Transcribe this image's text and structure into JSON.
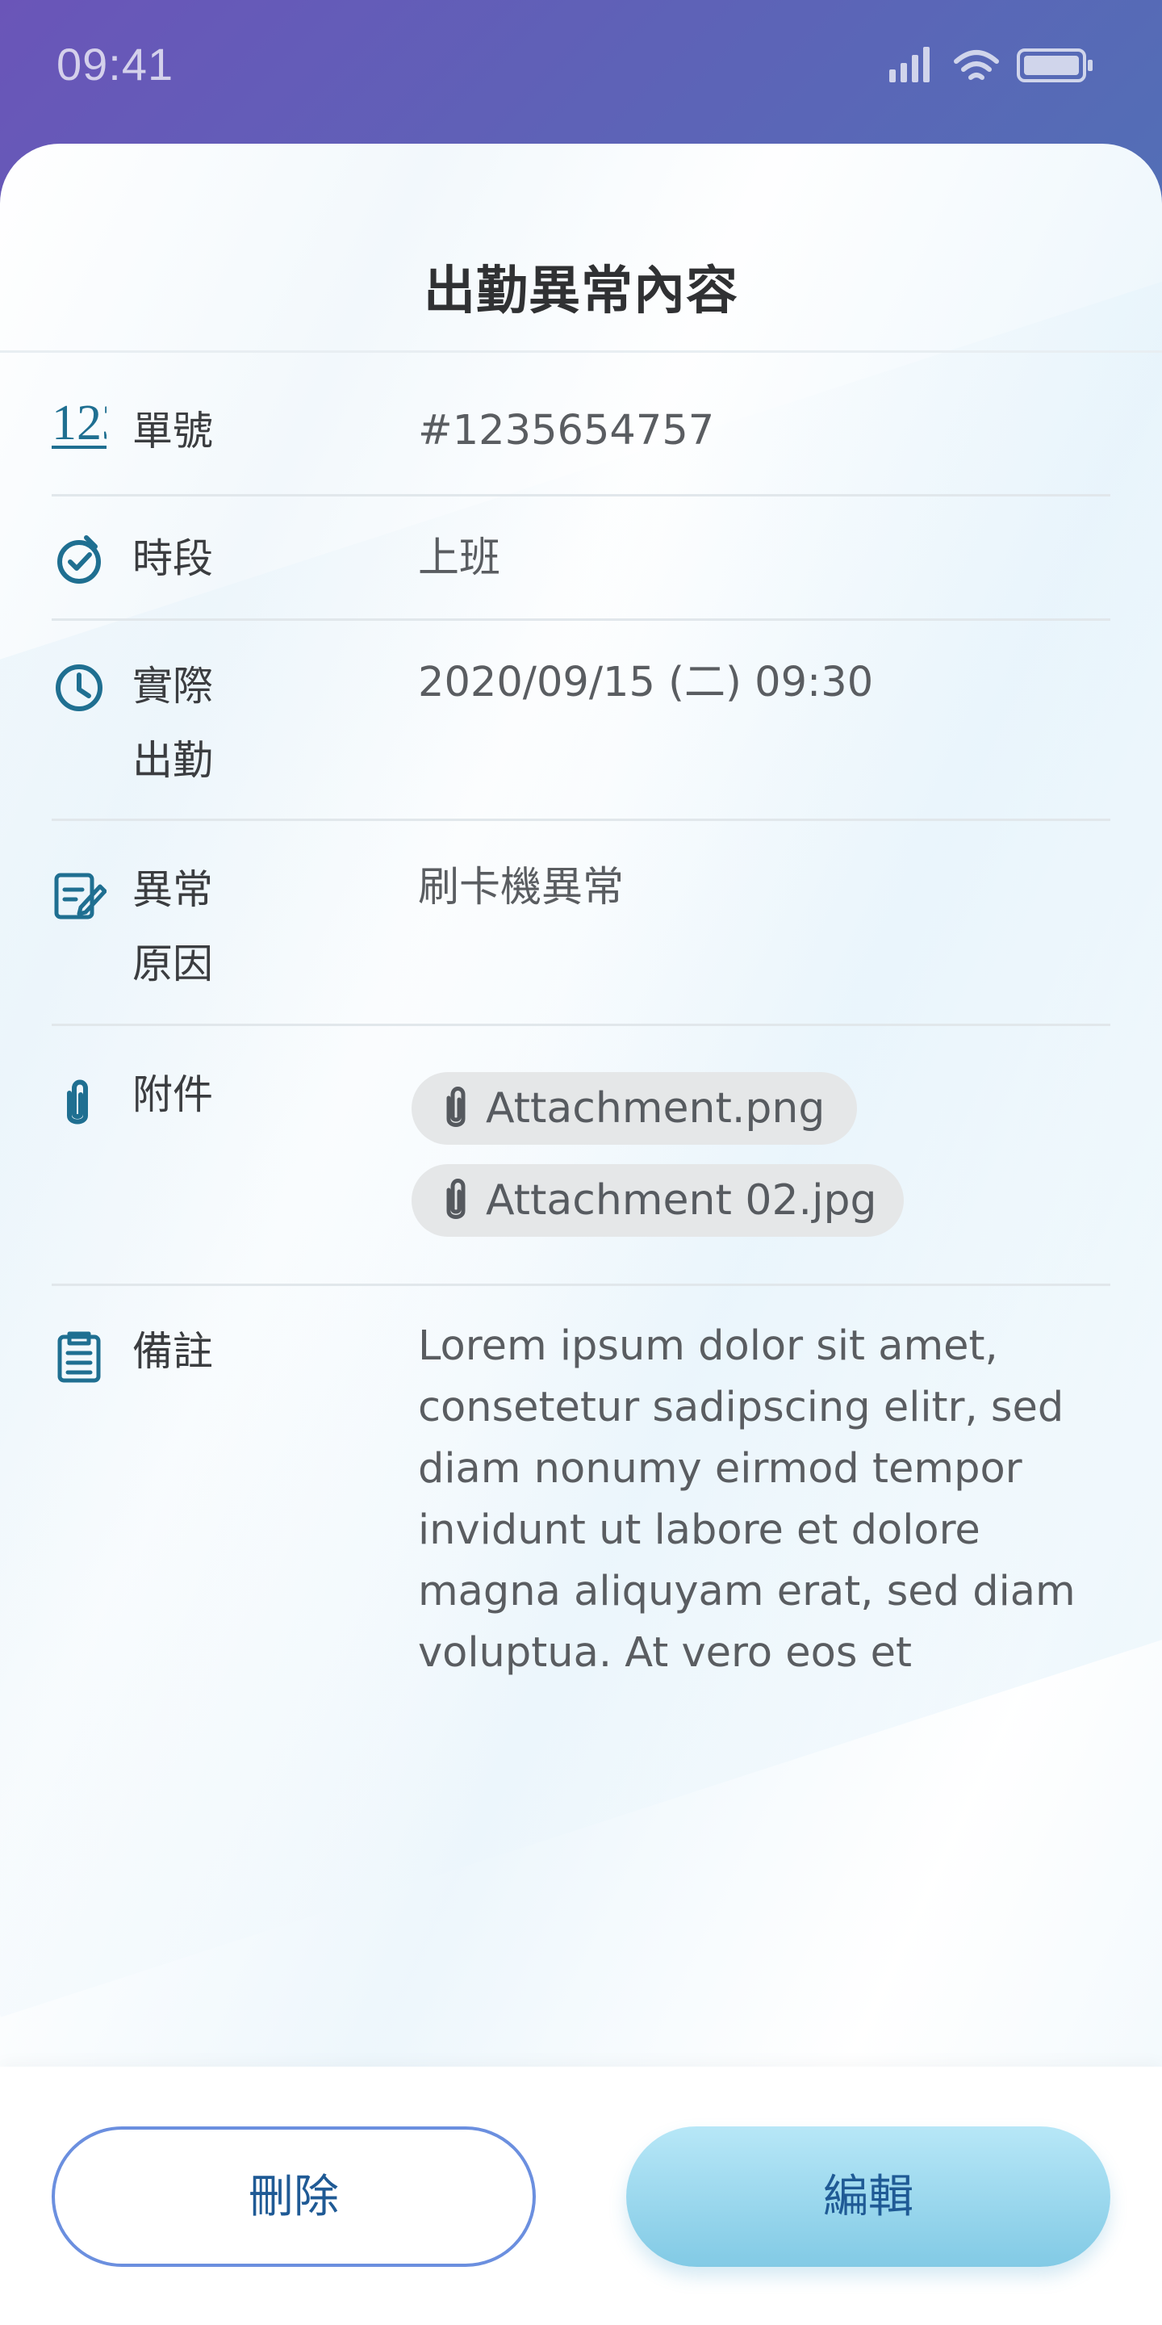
{
  "status_bar": {
    "time": "09:41",
    "icons": [
      "signal-icon",
      "wifi-icon",
      "battery-icon"
    ]
  },
  "header": {
    "title": "出勤異常內容"
  },
  "details": {
    "order_number": {
      "label": "單號",
      "value": "#1235654757",
      "icon": "number-icon"
    },
    "period": {
      "label": "時段",
      "value": "上班",
      "icon": "timer-check-icon"
    },
    "actual_attendance": {
      "label": "實際\n出勤",
      "value": "2020/09/15 (二)  09:30",
      "icon": "clock-icon"
    },
    "abnormal_reason": {
      "label": "異常\n原因",
      "value": "刷卡機異常",
      "icon": "edit-note-icon"
    },
    "attachments": {
      "label": "附件",
      "icon": "paperclip-icon",
      "files": [
        "Attachment.png",
        "Attachment 02.jpg"
      ]
    },
    "notes": {
      "label": "備註",
      "value": "Lorem ipsum dolor sit amet, consetetur sadipscing elitr, sed diam nonumy eirmod tempor invidunt ut labore et dolore magna aliquyam erat, sed diam voluptua. At vero eos et",
      "icon": "clipboard-icon"
    }
  },
  "actions": {
    "delete_label": "刪除",
    "edit_label": "編輯"
  },
  "colors": {
    "accent": "#1f6f91",
    "primary_text": "#3b3d40",
    "secondary_text": "#5a5d61",
    "chip_background": "#e5e7e8",
    "delete_border": "#6b8fdf",
    "edit_button": "#9dd8ee",
    "status_gradient_start": "#6a55b8",
    "status_gradient_end": "#3f8bb8"
  }
}
